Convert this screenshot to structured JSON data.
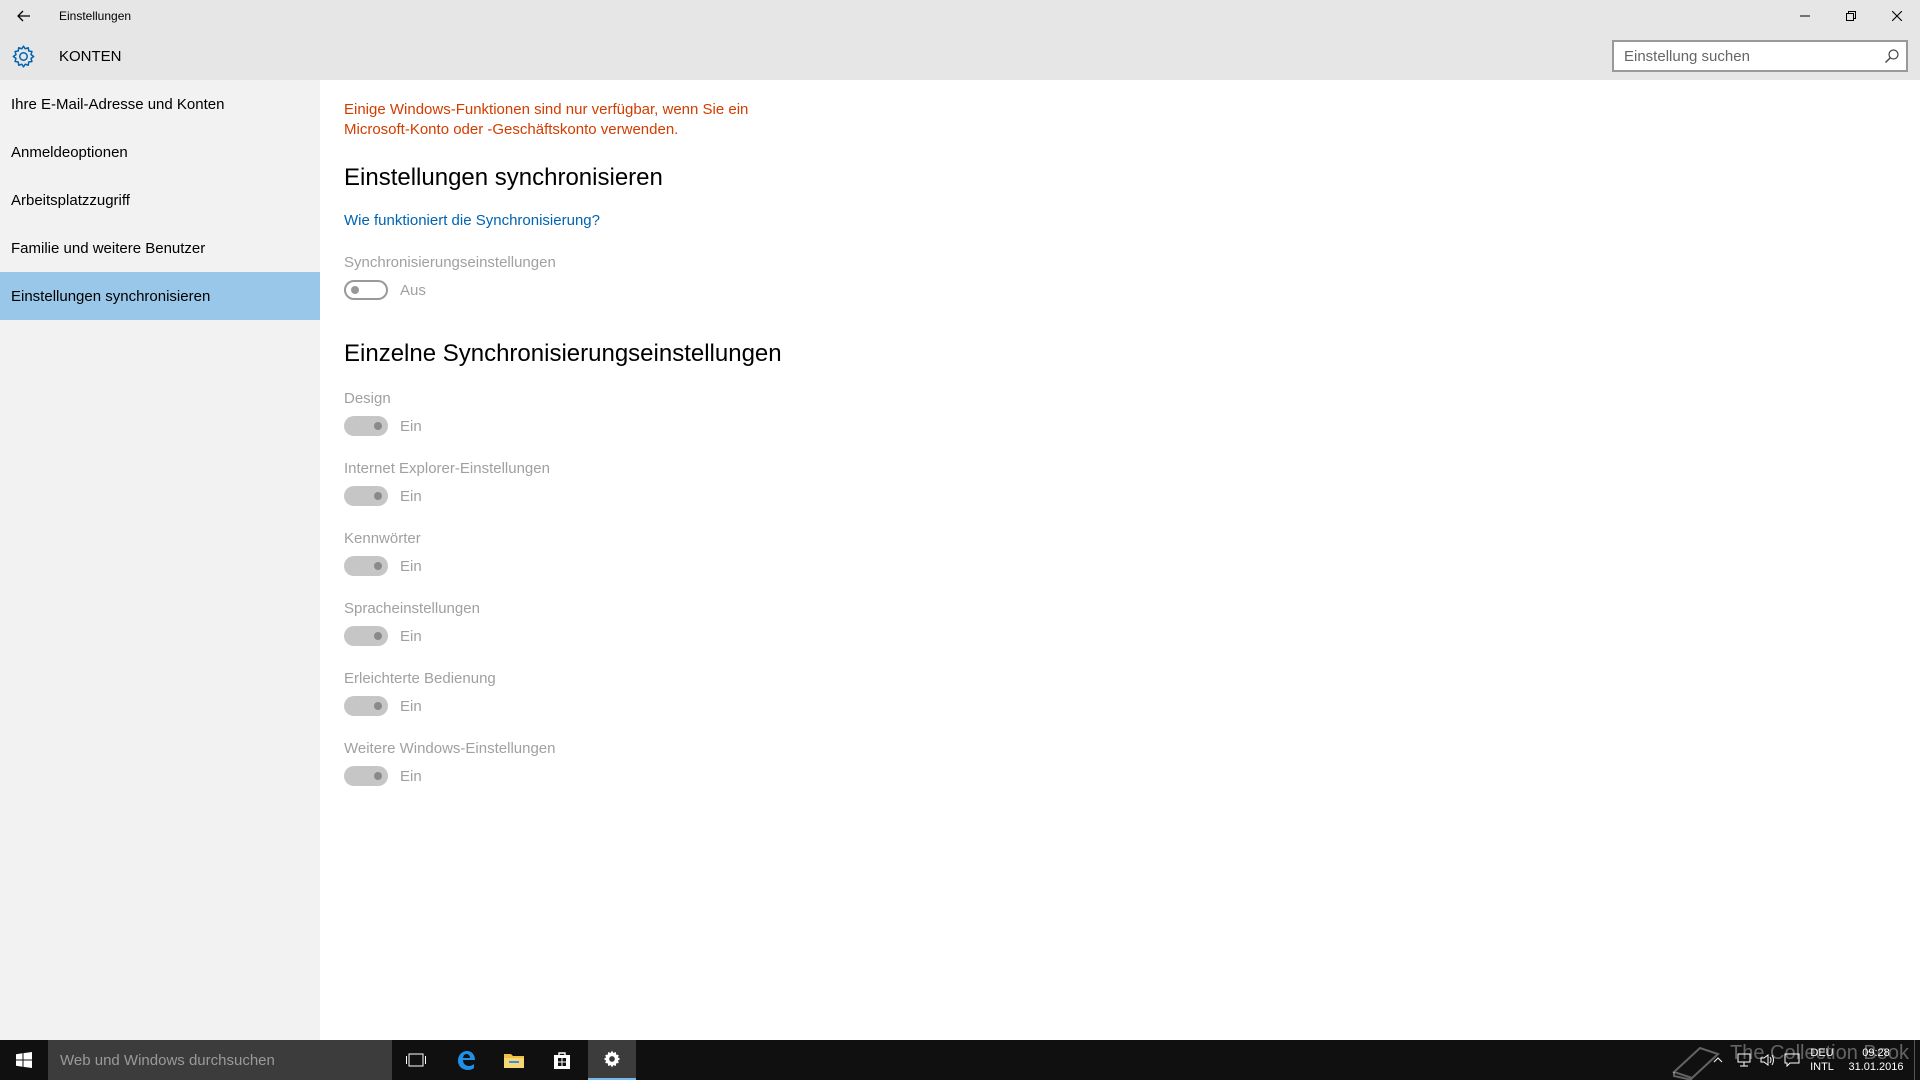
{
  "window": {
    "title": "Einstellungen"
  },
  "header": {
    "title": "KONTEN",
    "search_placeholder": "Einstellung suchen"
  },
  "sidebar": {
    "items": [
      {
        "label": "Ihre E-Mail-Adresse und Konten",
        "active": false
      },
      {
        "label": "Anmeldeoptionen",
        "active": false
      },
      {
        "label": "Arbeitsplatzzugriff",
        "active": false
      },
      {
        "label": "Familie und weitere Benutzer",
        "active": false
      },
      {
        "label": "Einstellungen synchronisieren",
        "active": true
      }
    ]
  },
  "content": {
    "warning_line1": "Einige Windows-Funktionen sind nur verfügbar, wenn Sie ein",
    "warning_line2": "Microsoft-Konto oder -Geschäftskonto verwenden.",
    "section1_title": "Einstellungen synchronisieren",
    "help_link": "Wie funktioniert die Synchronisierung?",
    "sync_label": "Synchronisierungseinstellungen",
    "sync_state": "Aus",
    "section2_title": "Einzelne Synchronisierungseinstellungen",
    "settings": [
      {
        "label": "Design",
        "state": "Ein"
      },
      {
        "label": "Internet Explorer-Einstellungen",
        "state": "Ein"
      },
      {
        "label": "Kennwörter",
        "state": "Ein"
      },
      {
        "label": "Spracheinstellungen",
        "state": "Ein"
      },
      {
        "label": "Erleichterte Bedienung",
        "state": "Ein"
      },
      {
        "label": "Weitere Windows-Einstellungen",
        "state": "Ein"
      }
    ]
  },
  "taskbar": {
    "search_placeholder": "Web und Windows durchsuchen",
    "lang_top": "DEU",
    "lang_bottom": "INTL",
    "time": "09:28",
    "date": "31.01.2016",
    "watermark": "The Collection Book"
  },
  "colors": {
    "accent": "#0063b1",
    "warning": "#d13d00",
    "selection": "#99c7ea",
    "chrome": "#e6e6e6"
  }
}
